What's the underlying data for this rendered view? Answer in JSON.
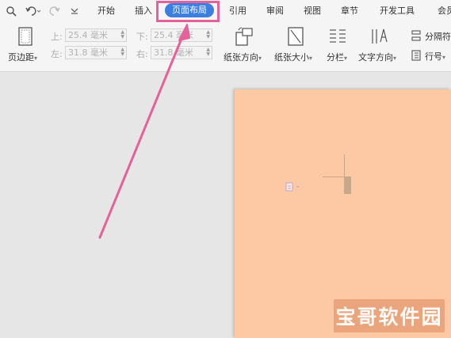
{
  "quick_access": [
    "print-preview-icon",
    "undo-icon",
    "redo-icon",
    "more-icon"
  ],
  "tabs": [
    {
      "label": "开始"
    },
    {
      "label": "插入"
    },
    {
      "label": "页面布局",
      "active": true
    },
    {
      "label": "引用"
    },
    {
      "label": "审阅"
    },
    {
      "label": "视图"
    },
    {
      "label": "章节"
    },
    {
      "label": "开发工具"
    },
    {
      "label": "会员"
    }
  ],
  "ribbon": {
    "margins_label": "页边距",
    "margins_dropdown": "▾",
    "top_label": "上:",
    "top_value": "25.4 毫米",
    "bottom_label": "下:",
    "bottom_value": "25.4 毫米",
    "left_label": "左:",
    "left_value": "31.8 毫米",
    "right_label": "右:",
    "right_value": "31.8 毫米",
    "orientation_label": "纸张方向",
    "size_label": "纸张大小",
    "columns_label": "分栏",
    "text_direction_label": "文字方向",
    "separator_label": "分隔符",
    "line_number_label": "行号"
  },
  "document": {
    "background_color": "#fcc9a4"
  },
  "watermark": {
    "text": "宝哥软件园"
  },
  "colors": {
    "accent": "#3d7fe0",
    "highlight": "#e4619a"
  }
}
